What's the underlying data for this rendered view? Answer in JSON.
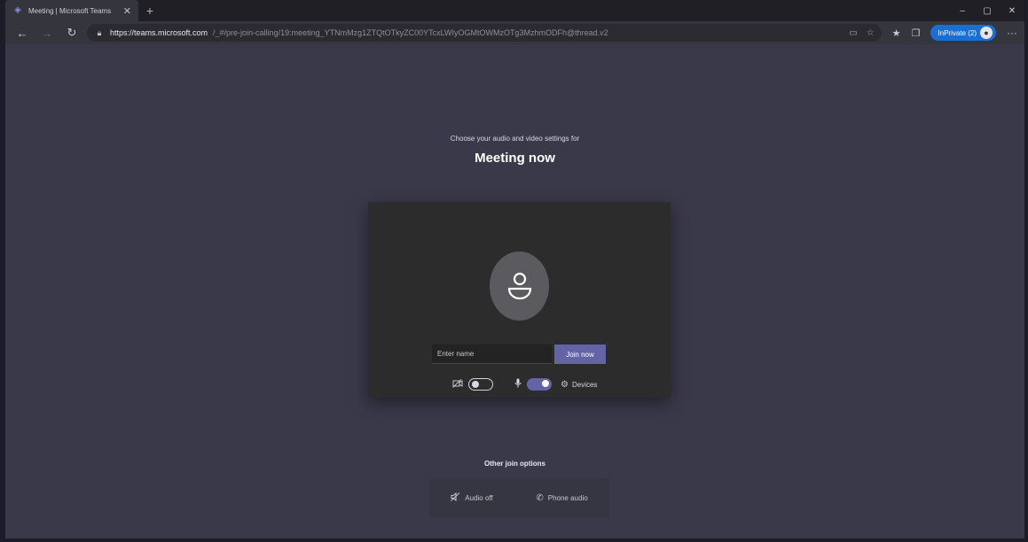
{
  "browser": {
    "tab_title": "Meeting | Microsoft Teams",
    "new_tab": "+",
    "url_host": "https://teams.microsoft.com",
    "url_path": "/_#/pre-join-calling/19:meeting_YTNmMzg1ZTQtOTkyZC00YTcxLWIyOGMtOWMzOTg3MzhmODFh@thread.v2",
    "inprivate_label": "InPrivate (2)",
    "accent_color": "#1a6fd4"
  },
  "window": {
    "minimize": "–",
    "restore": "▢",
    "close": "✕"
  },
  "prejoin": {
    "subtitle": "Choose your audio and video settings for",
    "meeting_title": "Meeting now",
    "name_placeholder": "Enter name",
    "join_label": "Join now",
    "camera_on": false,
    "mic_on": true,
    "devices_label": "Devices",
    "brand_color": "#6264a7"
  },
  "other_join": {
    "heading": "Other join options",
    "audio_off_label": "Audio off",
    "phone_audio_label": "Phone audio"
  }
}
